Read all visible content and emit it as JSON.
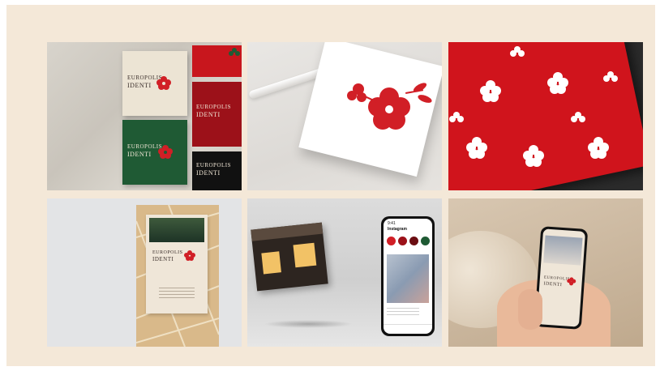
{
  "brand": {
    "line1": "EUROPOLIS",
    "line2": "IDENTI",
    "accent_red": "#d11f26",
    "deep_green": "#1f5a34",
    "cream": "#efe6d8"
  },
  "social_ui": {
    "header": "Instagram",
    "time": "9:41"
  },
  "icons": {
    "flower": "flower-icon",
    "phone": "phone-mockup-icon",
    "poster": "poster-stand-icon"
  }
}
